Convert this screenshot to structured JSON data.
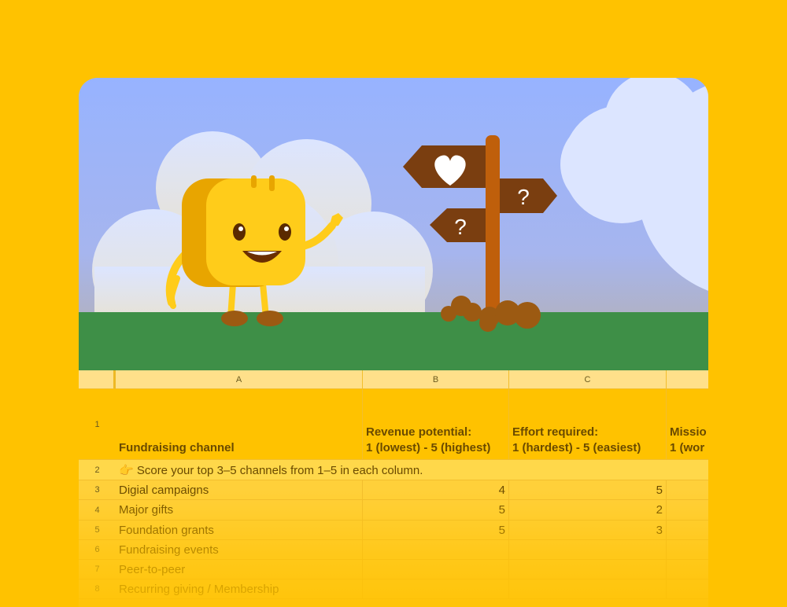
{
  "scene": {
    "character": "yellow-mascot",
    "signpost_icons": [
      "heart-icon",
      "question-icon",
      "question-icon"
    ],
    "sign_texts": [
      "?",
      "?"
    ]
  },
  "sheet": {
    "columns": [
      "A",
      "B",
      "C"
    ],
    "header_row_number": "1",
    "headers": {
      "a": "Fundraising channel",
      "b": "Revenue potential:\n1 (lowest) - 5 (highest)",
      "c": "Effort required:\n1 (hardest) - 5 (easiest)",
      "d": "Missio\n1 (wor"
    },
    "instruction_row_number": "2",
    "instruction": "👉 Score your top 3–5 channels from 1–5 in each column.",
    "rows": [
      {
        "num": "3",
        "channel": "Digial campaigns",
        "revenue": "4",
        "effort": "5"
      },
      {
        "num": "4",
        "channel": "Major gifts",
        "revenue": "5",
        "effort": "2"
      },
      {
        "num": "5",
        "channel": "Foundation grants",
        "revenue": "5",
        "effort": "3"
      },
      {
        "num": "6",
        "channel": "Fundraising events",
        "revenue": "",
        "effort": ""
      },
      {
        "num": "7",
        "channel": "Peer-to-peer",
        "revenue": "",
        "effort": ""
      },
      {
        "num": "8",
        "channel": "Recurring giving / Membership",
        "revenue": "",
        "effort": ""
      }
    ]
  },
  "colors": {
    "background": "#FFC200",
    "sky": "#97B3FF",
    "grass": "#3E8F47",
    "signpost": "#7A3E10",
    "mascot": "#FFCC1A"
  }
}
